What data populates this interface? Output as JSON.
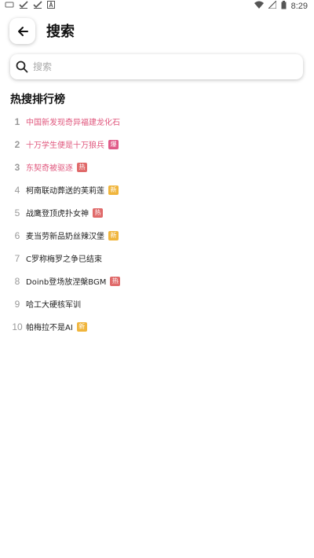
{
  "status_bar": {
    "left_icons": [
      "notification-icon",
      "check-icon",
      "check-icon",
      "a-icon"
    ],
    "time": "8:29"
  },
  "header": {
    "title": "搜索"
  },
  "search": {
    "placeholder": "搜索",
    "value": ""
  },
  "hot_search": {
    "title": "热搜排行榜",
    "items": [
      {
        "rank": "1",
        "text": "中国新发现奇异福建龙化石",
        "tag": "",
        "tag_type": "",
        "top": true
      },
      {
        "rank": "2",
        "text": "十万学生便是十万狼兵",
        "tag": "爆",
        "tag_type": "boil",
        "top": true
      },
      {
        "rank": "3",
        "text": "东契奇被驱逐",
        "tag": "热",
        "tag_type": "hot",
        "top": true
      },
      {
        "rank": "4",
        "text": "柯南联动葬送的芙莉莲",
        "tag": "新",
        "tag_type": "new",
        "top": false
      },
      {
        "rank": "5",
        "text": "战鹰登顶虎扑女神",
        "tag": "热",
        "tag_type": "hot",
        "top": false
      },
      {
        "rank": "6",
        "text": "麦当劳新品奶丝辣汉堡",
        "tag": "新",
        "tag_type": "new",
        "top": false
      },
      {
        "rank": "7",
        "text": "C罗称梅罗之争已结束",
        "tag": "",
        "tag_type": "",
        "top": false
      },
      {
        "rank": "8",
        "text": "Doinb登场放涅槃BGM",
        "tag": "热",
        "tag_type": "hot",
        "top": false
      },
      {
        "rank": "9",
        "text": "哈工大硬核军训",
        "tag": "",
        "tag_type": "",
        "top": false
      },
      {
        "rank": "10",
        "text": "帕梅拉不是AI",
        "tag": "新",
        "tag_type": "new",
        "top": false
      }
    ]
  },
  "colors": {
    "top_rank_text": "#e0587e",
    "tag_hot": "#e06a6a",
    "tag_new": "#f0b53c",
    "tag_boil": "#e05a88"
  }
}
